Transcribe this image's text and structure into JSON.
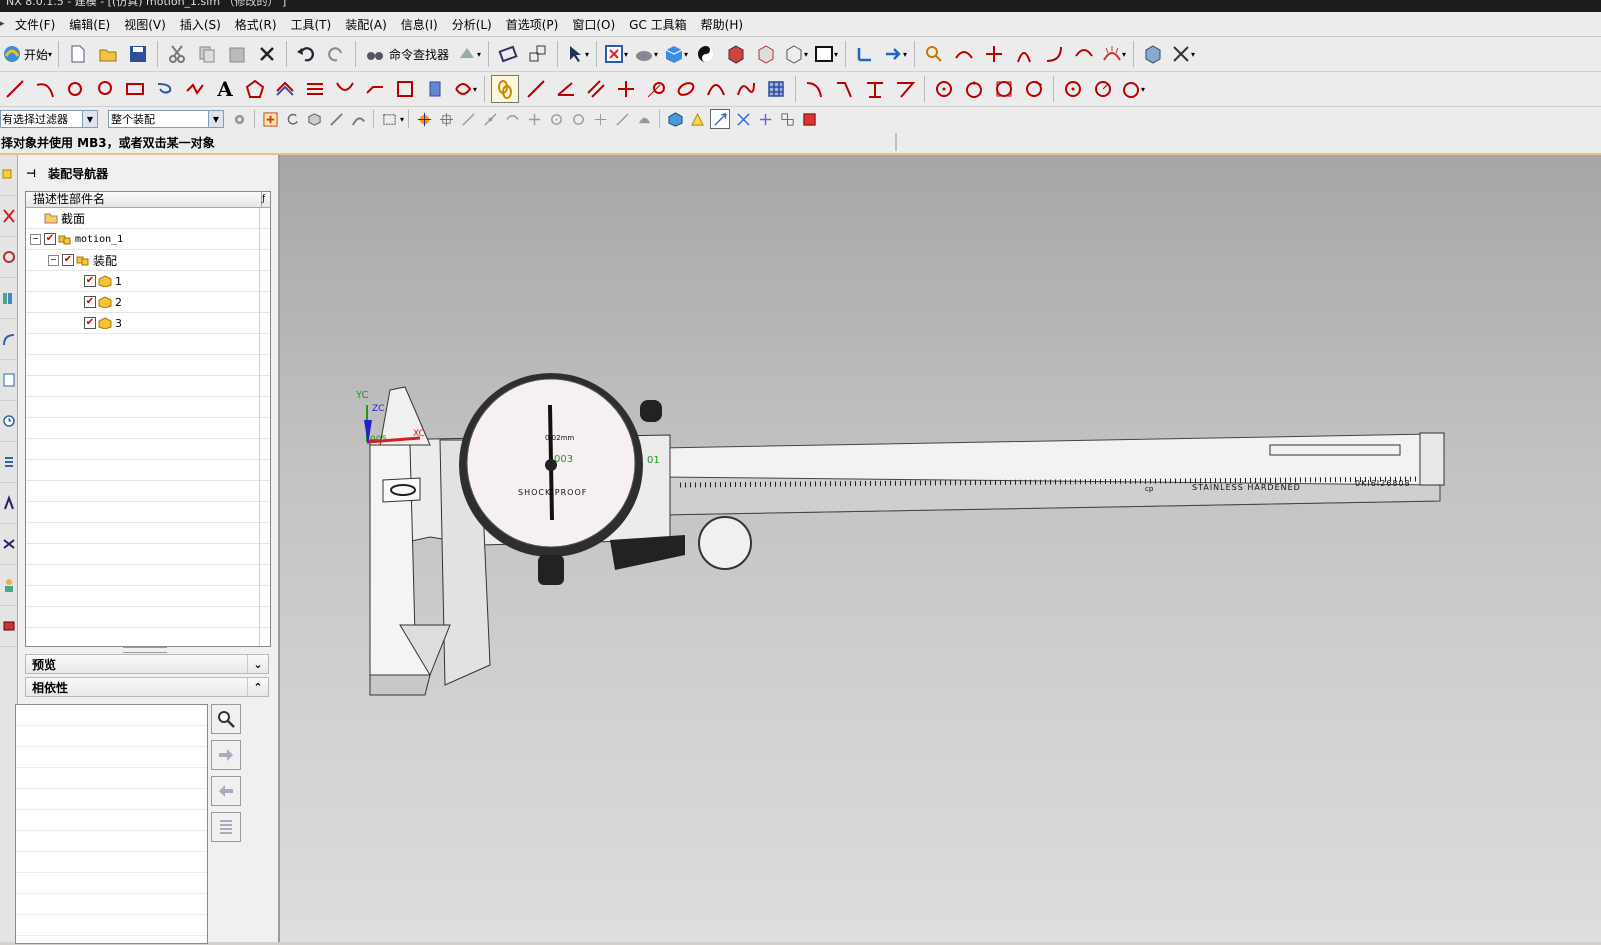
{
  "title": "NX 8.0.1.5 - 建模 - [(仿真) motion_1.sim （修改的） ]",
  "menu": [
    "文件(F)",
    "编辑(E)",
    "视图(V)",
    "插入(S)",
    "格式(R)",
    "工具(T)",
    "装配(A)",
    "信息(I)",
    "分析(L)",
    "首选项(P)",
    "窗口(O)",
    "GC 工具箱",
    "帮助(H)"
  ],
  "toolbar": {
    "start_label": "开始",
    "finder_label": "命令查找器"
  },
  "selection": {
    "filter": "有选择过滤器",
    "scope": "整个装配"
  },
  "cue": "择对象并使用 MB3，或者双击某一对象",
  "navigator": {
    "title": "装配导航器",
    "column": "描述性部件名",
    "rows": [
      {
        "label": "截面",
        "checked": false,
        "type": "folder"
      },
      {
        "label": "motion_1",
        "checked": true,
        "type": "assembly"
      },
      {
        "label": "装配",
        "checked": true,
        "type": "assembly"
      },
      {
        "label": "1",
        "checked": true,
        "type": "part"
      },
      {
        "label": "2",
        "checked": true,
        "type": "part"
      },
      {
        "label": "3",
        "checked": true,
        "type": "part"
      }
    ]
  },
  "panels": {
    "preview": "预览",
    "dependency": "相依性"
  },
  "model": {
    "wcs": {
      "yc": "YC",
      "zc": "ZC",
      "xc": "XC"
    },
    "dial": {
      "brand": "SHOCK PROOF",
      "unit": "0.02mm",
      "tag": "003",
      "tag2": "01",
      "tag3": "005"
    },
    "scale_text": "STAINLESS HARDENED",
    "serial": "0KI6I26808",
    "cp": "cp"
  },
  "colors": {
    "title_bg": "#1c1c1c",
    "toolbar_bg": "#ececec",
    "check": "#cc0000",
    "wcs_x": "#d42020",
    "wcs_y": "#1e9a1e",
    "wcs_z": "#2222cc"
  }
}
